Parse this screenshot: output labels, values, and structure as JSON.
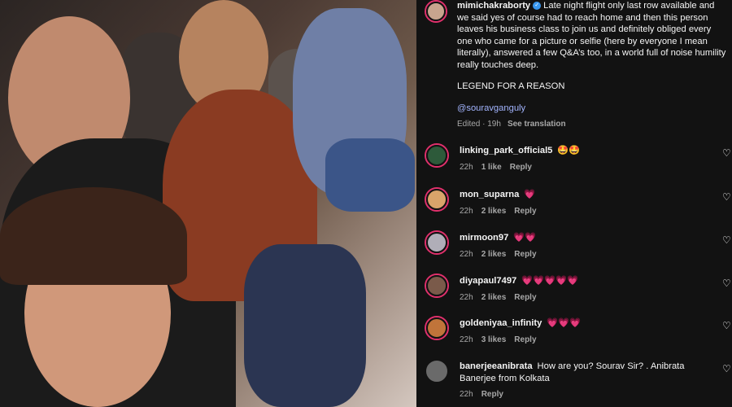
{
  "post": {
    "username": "mimichakraborty",
    "verified_glyph": "✓",
    "caption": "Late night flight only last row available and we said yes of course had to reach home and then this person leaves his business class to join us and definitely obliged every one who came for a picture or selfie (here by everyone I mean literally), answered a few Q&A’s too, in a world full of noise humility really touches deep.",
    "tagline": "LEGEND FOR A REASON",
    "mention": "@souravganguly",
    "edited": "Edited · 19h",
    "see_translation": "See translation"
  },
  "comments": [
    {
      "username": "linking_park_official5",
      "text": "🤩🤩",
      "time": "22h",
      "likes": "1 like",
      "reply": "Reply",
      "avatar_color": "#2d5a3a"
    },
    {
      "username": "mon_suparna",
      "text": "💗",
      "time": "22h",
      "likes": "2 likes",
      "reply": "Reply",
      "avatar_color": "#d9a46a"
    },
    {
      "username": "mirmoon97",
      "text": "💗💗",
      "time": "22h",
      "likes": "2 likes",
      "reply": "Reply",
      "avatar_color": "#b0aeb8"
    },
    {
      "username": "diyapaul7497",
      "text": "💗💗💗💗💗",
      "time": "22h",
      "likes": "2 likes",
      "reply": "Reply",
      "avatar_color": "#7a5a4a"
    },
    {
      "username": "goldeniyaa_infinity",
      "text": "💗💗💗",
      "time": "22h",
      "likes": "3 likes",
      "reply": "Reply",
      "avatar_color": "#c0743a"
    },
    {
      "username": "banerjeeanibrata",
      "text": "How are you? Sourav Sir? . Anibrata Banerjee from Kolkata",
      "time": "22h",
      "likes": "",
      "reply": "Reply",
      "avatar_color": "#6a6a6a"
    }
  ],
  "icons": {
    "heart": "heart-icon"
  },
  "heart_glyph": "♡",
  "colors": {
    "panel_bg": "#121212",
    "mention": "#a3b5ff",
    "muted": "#a8a8a8",
    "story_ring": "#e1306c"
  }
}
